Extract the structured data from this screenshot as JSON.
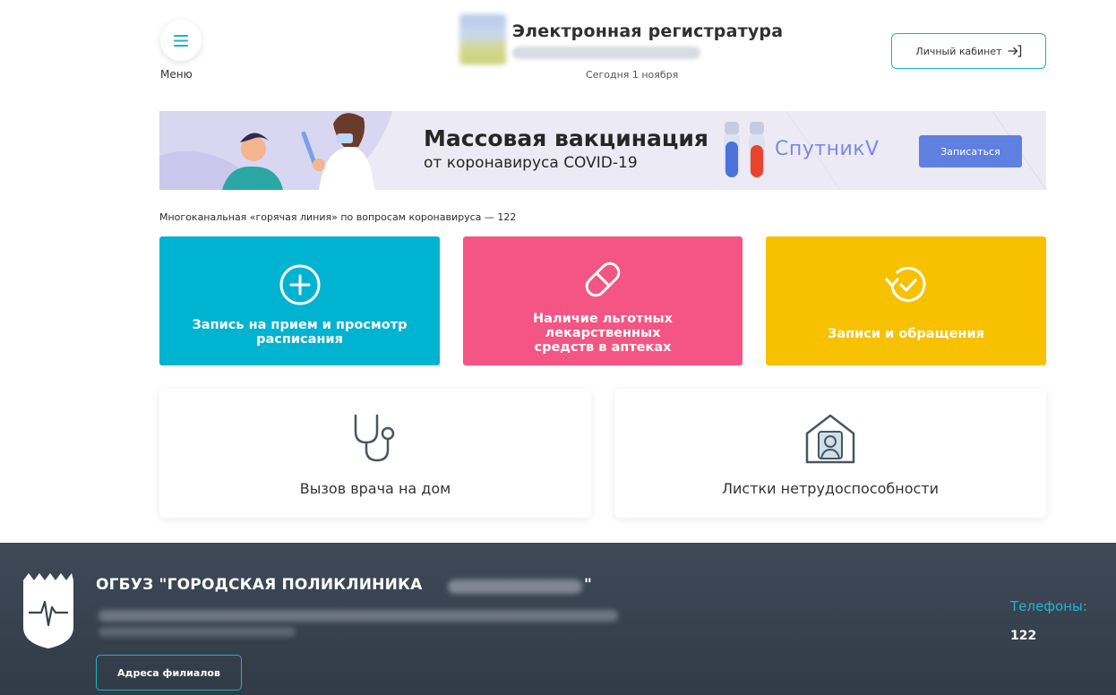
{
  "header": {
    "menu_label": "Меню",
    "title": "Электронная регистратура",
    "today": "Сегодня 1 ноября",
    "cabinet_label": "Личный кабинет"
  },
  "banner": {
    "title": "Массовая вакцинация",
    "subtitle": "от коронавируса COVID-19",
    "brand": "СпутникV",
    "button_label": "Записаться"
  },
  "hotline": "Многоканальная «горячая линия» по вопросам коронавируса — 122",
  "tiles": [
    {
      "label": "Запись на прием и просмотр расписания",
      "icon": "plus-circle-icon",
      "color": "#00b3d1"
    },
    {
      "label": "Наличие льготных лекарственных средств в аптеках",
      "icon": "pill-icon",
      "color": "#f45584"
    },
    {
      "label": "Записи и обращения",
      "icon": "history-clock-icon",
      "color": "#f8c100"
    }
  ],
  "cards": [
    {
      "label": "Вызов врача на дом",
      "icon": "stethoscope-icon"
    },
    {
      "label": "Листки нетрудоспособности",
      "icon": "home-doctor-icon"
    }
  ],
  "footer": {
    "org_name": "ОГБУЗ \"ГОРОДСКАЯ ПОЛИКЛИНИКА",
    "org_name_end": "\"",
    "branches_button": "Адреса филиалов",
    "phones_label": "Телефоны:",
    "phone": "122"
  },
  "colors": {
    "accent": "#20b2c8",
    "banner_button": "#5f80e0",
    "footer_bg": "#3a4451"
  }
}
